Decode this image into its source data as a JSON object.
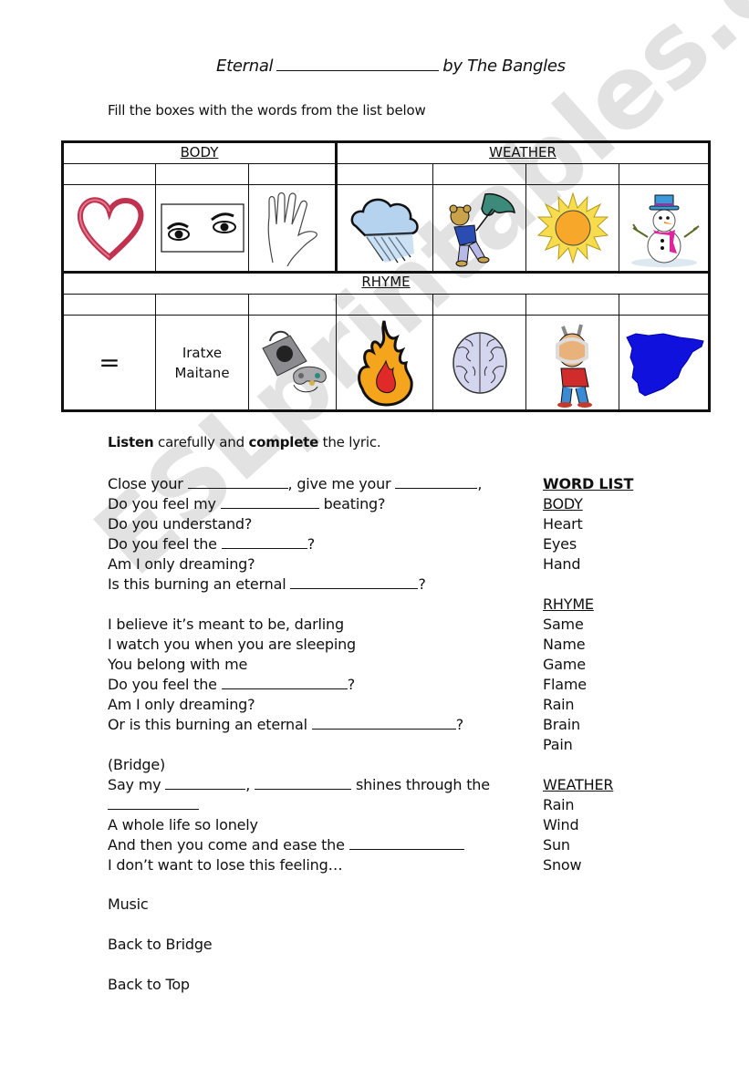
{
  "header": {
    "title_prefix": "Eternal",
    "title_suffix": "by The Bangles",
    "instruction": "Fill the boxes with the words from the list below"
  },
  "picture_table": {
    "categories": {
      "body": "BODY",
      "weather": "WEATHER",
      "rhyme": "RHYME"
    },
    "body_images": [
      "heart-icon",
      "eyes-icon",
      "hand-icon"
    ],
    "weather_images": [
      "rain-cloud-icon",
      "wind-umbrella-bear-icon",
      "sun-icon",
      "snowman-icon"
    ],
    "rhyme_items": [
      {
        "type": "symbol",
        "text": "="
      },
      {
        "type": "text",
        "lines": [
          "Iratxe",
          "Maitane"
        ]
      },
      {
        "type": "image",
        "icon": "game-console-icon"
      },
      {
        "type": "image",
        "icon": "flame-icon"
      },
      {
        "type": "image",
        "icon": "brain-icon"
      },
      {
        "type": "image",
        "icon": "toothache-boy-icon"
      },
      {
        "type": "image",
        "icon": "spain-map-icon"
      }
    ]
  },
  "task": {
    "bold1": "Listen",
    "mid": " carefully and ",
    "bold2": "complete",
    "end": " the lyric."
  },
  "lyrics": {
    "verse1": [
      [
        "Close your ",
        "",
        ", give me your ",
        "",
        ","
      ],
      [
        "Do you feel my ",
        "",
        " beating?"
      ],
      [
        "Do you understand?"
      ],
      [
        "Do you feel the ",
        "",
        "?"
      ],
      [
        "Am I only dreaming?"
      ],
      [
        "Is this burning an eternal ",
        "",
        "?"
      ]
    ],
    "verse2": [
      "I believe it’s meant to be, darling",
      "I watch you when you are sleeping",
      "You belong with me",
      "Do you feel the",
      "Am I only dreaming?",
      "Or is this burning an eternal"
    ],
    "bridge": {
      "label": "(Bridge)",
      "say_my": "Say my",
      "shines": "shines through the",
      "lonely": "A whole life so lonely",
      "ease": "And then you come and ease the",
      "feeling": "I don’t want to lose this feeling…"
    },
    "q": "?",
    "comma": ","
  },
  "tail": {
    "music": "Music",
    "back_bridge": "Back to Bridge",
    "back_top": "Back to Top"
  },
  "word_list": {
    "title": "WORD LIST",
    "body_label": "BODY",
    "body": [
      "Heart",
      "Eyes",
      "Hand"
    ],
    "rhyme_label": "RHYME",
    "rhyme": [
      "Same",
      "Name",
      "Game",
      "Flame",
      "Rain",
      "Brain",
      "Pain"
    ],
    "weather_label": "WEATHER",
    "weather": [
      "Rain",
      "Wind",
      "Sun",
      "Snow"
    ]
  },
  "watermark": "ESLprintables.com"
}
